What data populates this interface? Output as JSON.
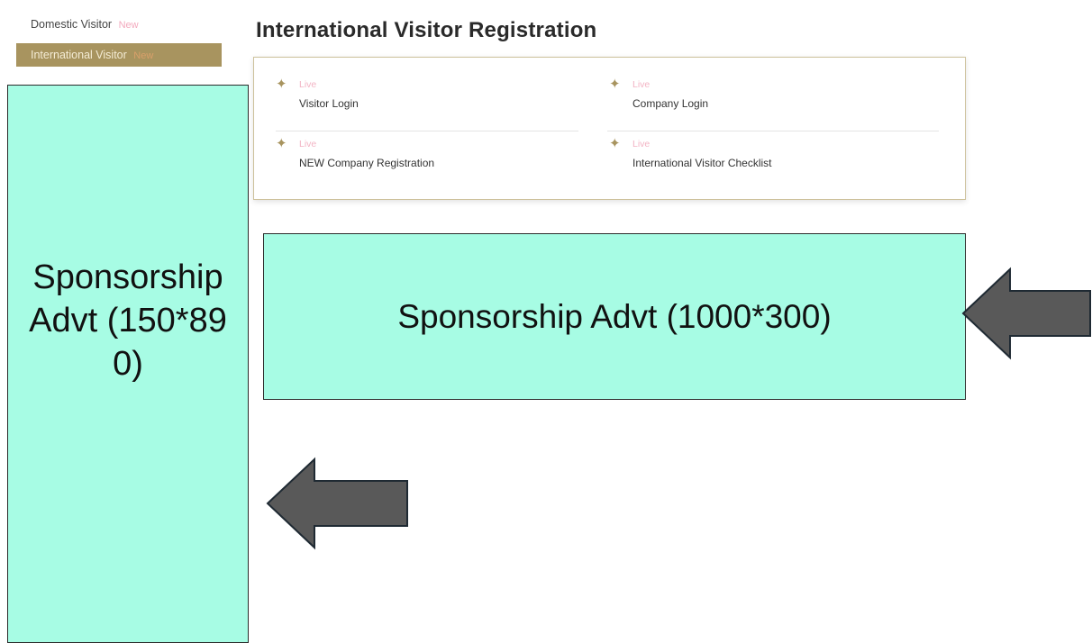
{
  "sidebar": {
    "items": [
      {
        "label": "Domestic Visitor",
        "badge": "New"
      },
      {
        "label": "International Visitor",
        "badge": "New"
      }
    ]
  },
  "page": {
    "title": "International Visitor Registration"
  },
  "links": [
    {
      "status": "Live",
      "label": "Visitor Login"
    },
    {
      "status": "Live",
      "label": "Company Login"
    },
    {
      "status": "Live",
      "label": "NEW Company Registration"
    },
    {
      "status": "Live",
      "label": "International Visitor Checklist"
    }
  ],
  "ads": {
    "side": "Sponsorship Advt (150*890)",
    "banner": "Sponsorship Advt (1000*300)"
  },
  "colors": {
    "accent_gold": "#a8945f",
    "ad_fill": "#a7fce4",
    "arrow_fill": "#595959",
    "live_pink": "#f3b4c4"
  },
  "icons": {
    "link_bullet": "star-icon",
    "callouts": "arrow-left-icon"
  }
}
